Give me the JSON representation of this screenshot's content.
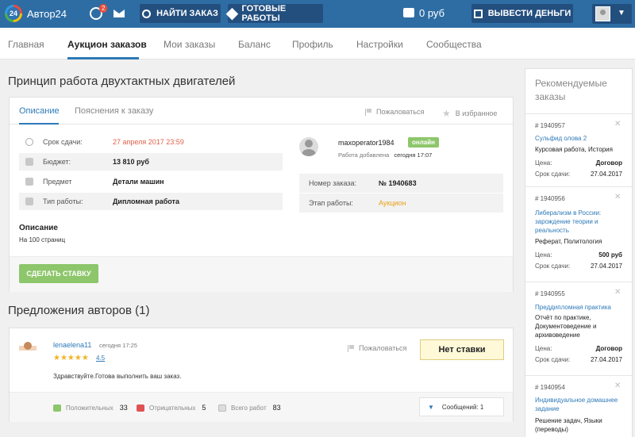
{
  "header": {
    "logo_badge": "24",
    "logo_text": "Автор24",
    "notif_count": "2",
    "find_orders": "НАЙТИ ЗАКАЗ",
    "ready_works": "ГОТОВЫЕ РАБОТЫ",
    "balance": "0 руб",
    "withdraw": "ВЫВЕСТИ ДЕНЬГИ",
    "icons": [
      "globe-icon",
      "mail-icon",
      "search-icon",
      "tag-icon",
      "wallet-icon",
      "money-icon",
      "chevron-down-icon"
    ]
  },
  "nav": [
    "Главная",
    "Аукцион заказов",
    "Мои заказы",
    "Баланс",
    "Профиль",
    "Настройки",
    "Сообщества"
  ],
  "nav_active": "Аукцион заказов",
  "page_title": "Принцип работа двухтактных двигателей",
  "order": {
    "tabs": [
      "Описание",
      "Пояснения к заказу"
    ],
    "report": "Пожаловаться",
    "favorite": "В избранное",
    "rows": [
      {
        "label": "Срок сдачи:",
        "value": "27 апреля 2017 23:59"
      },
      {
        "label": "Бюджет:",
        "value": "13 810 руб"
      },
      {
        "label": "Предмет",
        "value": "Детали машин"
      },
      {
        "label": "Тип работы:",
        "value": "Дипломная работа"
      }
    ],
    "desc_title": "Описание",
    "desc_text": "На 100 страниц",
    "bid_button": "СДЕЛАТЬ СТАВКУ",
    "customer": {
      "name": "maxoperator1984",
      "status": "онлайн",
      "added_label": "Работа добавлена",
      "added_value": "сегодня 17:07"
    },
    "meta": [
      {
        "label": "Номер заказа:",
        "value": "№ 1940683"
      },
      {
        "label": "Этап работы:",
        "value": "Аукцион"
      }
    ]
  },
  "offers": {
    "title": "Предложения авторов (1)",
    "items": [
      {
        "author": "lenaelena11",
        "time": "сегодня 17:25",
        "stars": "★★★★★",
        "rating": "4.5",
        "message": "Здравствуйте.Готова выполнить ваш заказ.",
        "report": "Пожаловаться",
        "bid": "Нет ставки",
        "positive_label": "Положительных",
        "positive": "33",
        "negative_label": "Отрицательных",
        "negative": "5",
        "total_label": "Всего работ",
        "total": "83",
        "messages": "Сообщений: 1"
      }
    ]
  },
  "sidebar": {
    "title": "Рекомендуемые заказы",
    "items": [
      {
        "num": "# 1940957",
        "subject": "Сульфид олова 2",
        "kind": "Курсовая работа, История",
        "price_label": "Цена:",
        "price": "Договор",
        "deadline_label": "Срок сдачи:",
        "deadline": "27.04.2017"
      },
      {
        "num": "# 1940956",
        "subject": "Либерализм в России: зарождение теории и реальность",
        "kind": "Реферат, Политология",
        "price_label": "Цена:",
        "price": "500 руб",
        "deadline_label": "Срок сдачи:",
        "deadline": "27.04.2017"
      },
      {
        "num": "# 1940955",
        "subject": "Преддипломная практика",
        "kind": "Отчёт по практике, Документоведение и архивоведение",
        "price_label": "Цена:",
        "price": "Договор",
        "deadline_label": "Срок сдачи:",
        "deadline": "27.04.2017"
      },
      {
        "num": "# 1940954",
        "subject": "Индивидуальное домашнее задание",
        "kind": "Решение задач, Языки (переводы)",
        "price_label": "",
        "price": "",
        "deadline_label": "",
        "deadline": ""
      }
    ]
  }
}
